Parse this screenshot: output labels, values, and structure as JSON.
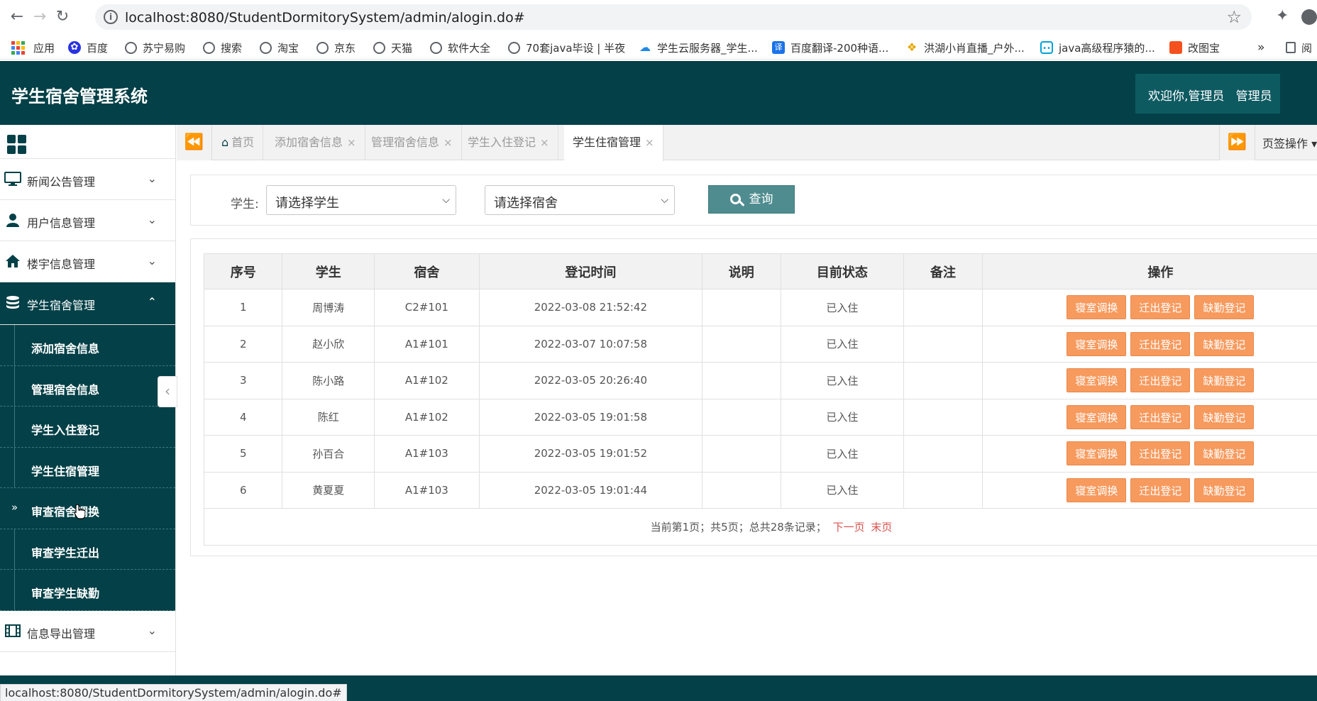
{
  "browser": {
    "url": "localhost:8080/StudentDormitorySystem/admin/alogin.do#",
    "bookmarks": [
      "应用",
      "百度",
      "苏宁易购",
      "搜索",
      "淘宝",
      "京东",
      "天猫",
      "软件大全",
      "70套java毕设 | 半夜",
      "学生云服务器_学生...",
      "百度翻译-200种语...",
      "洪湖小肖直播_户外...",
      "java高级程序猿的...",
      "改图宝"
    ],
    "more_bookmarks": "»",
    "reading_list": "阅",
    "status_url": "localhost:8080/StudentDormitorySystem/admin/alogin.do#"
  },
  "header": {
    "title": "学生宿舍管理系统",
    "welcome": "欢迎你,管理员",
    "role": "管理员"
  },
  "sidebar": {
    "menus": [
      {
        "label": "新闻公告管理",
        "icon": "monitor-icon"
      },
      {
        "label": "用户信息管理",
        "icon": "user-icon"
      },
      {
        "label": "楼宇信息管理",
        "icon": "home-icon"
      },
      {
        "label": "学生宿舍管理",
        "icon": "database-icon"
      },
      {
        "label": "信息导出管理",
        "icon": "film-icon"
      }
    ],
    "submenu": [
      "添加宿舍信息",
      "管理宿舍信息",
      "学生入住登记",
      "学生住宿管理",
      "审查宿舍调换",
      "审查学生迁出",
      "审查学生缺勤"
    ]
  },
  "tabs": {
    "items": [
      "首页",
      "添加宿舍信息",
      "管理宿舍信息",
      "学生入住登记",
      "学生住宿管理"
    ],
    "ops_label": "页签操作"
  },
  "filter": {
    "student_label": "学生:",
    "student_placeholder": "请选择学生",
    "dorm_placeholder": "请选择宿舍",
    "query_label": "查询"
  },
  "table": {
    "headers": [
      "序号",
      "学生",
      "宿舍",
      "登记时间",
      "说明",
      "目前状态",
      "备注",
      "操作"
    ],
    "rows": [
      {
        "no": "1",
        "student": "周博涛",
        "dorm": "C2#101",
        "time": "2022-03-08 21:52:42",
        "desc": "",
        "status": "已入住",
        "note": ""
      },
      {
        "no": "2",
        "student": "赵小欣",
        "dorm": "A1#101",
        "time": "2022-03-07 10:07:58",
        "desc": "",
        "status": "已入住",
        "note": ""
      },
      {
        "no": "3",
        "student": "陈小路",
        "dorm": "A1#102",
        "time": "2022-03-05 20:26:40",
        "desc": "",
        "status": "已入住",
        "note": ""
      },
      {
        "no": "4",
        "student": "陈红",
        "dorm": "A1#102",
        "time": "2022-03-05 19:01:58",
        "desc": "",
        "status": "已入住",
        "note": ""
      },
      {
        "no": "5",
        "student": "孙百合",
        "dorm": "A1#103",
        "time": "2022-03-05 19:01:52",
        "desc": "",
        "status": "已入住",
        "note": ""
      },
      {
        "no": "6",
        "student": "黄夏夏",
        "dorm": "A1#103",
        "time": "2022-03-05 19:01:44",
        "desc": "",
        "status": "已入住",
        "note": ""
      }
    ],
    "actions": [
      "寝室调换",
      "迁出登记",
      "缺勤登记"
    ],
    "pager_text": "当前第1页；共5页；总共28条记录；",
    "next_label": "下一页",
    "last_label": "末页"
  },
  "colors": {
    "brand": "#034047",
    "action_button": "#f79a5e",
    "query_button": "#4f8c8f",
    "pager_link": "#d9534f"
  }
}
